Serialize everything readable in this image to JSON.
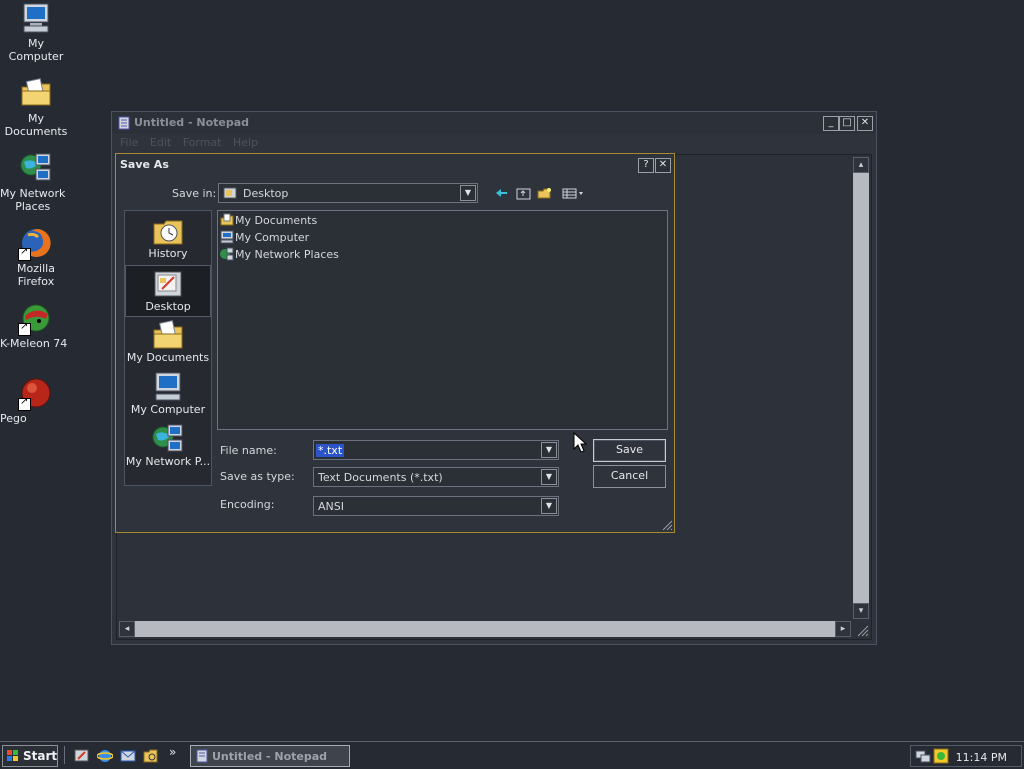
{
  "desktop": {
    "icons": [
      {
        "label": "My Computer"
      },
      {
        "label": "My Documents"
      },
      {
        "label_line1": "My Network",
        "label_line2": "Places"
      },
      {
        "label": "Mozilla Firefox"
      },
      {
        "label": "K-Meleon 74"
      },
      {
        "label": "Pego"
      }
    ]
  },
  "notepad": {
    "title": "Untitled - Notepad",
    "menu": [
      "File",
      "Edit",
      "Format",
      "Help"
    ],
    "controls": {
      "minimize": "_",
      "maximize": "□",
      "close": "✕"
    }
  },
  "dialog": {
    "title": "Save As",
    "help_btn": "?",
    "close_btn": "✕",
    "save_in_label": "Save in:",
    "save_in_value": "Desktop",
    "places": [
      "History",
      "Desktop",
      "My Documents",
      "My Computer",
      "My Network P..."
    ],
    "files": [
      "My Documents",
      "My Computer",
      "My Network Places"
    ],
    "file_name_label": "File name:",
    "file_name_value": "*.txt",
    "save_as_type_label": "Save as type:",
    "save_as_type_value": "Text Documents (*.txt)",
    "encoding_label": "Encoding:",
    "encoding_value": "ANSI",
    "save_button": "Save",
    "cancel_button": "Cancel",
    "toolbar_icons": [
      "back-icon",
      "up-folder-icon",
      "new-folder-icon",
      "views-menu-icon"
    ]
  },
  "taskbar": {
    "start_label": "Start",
    "task_label": "Untitled - Notepad",
    "clock": "11:14 PM",
    "quicklaunch": [
      "show-desktop-icon",
      "ie-icon",
      "outlook-icon",
      "explorer-icon"
    ],
    "chevron": "»"
  },
  "colors": {
    "desktop_bg": "#262a33",
    "dialog_border": "#a8892d",
    "selection": "#2a54c8"
  }
}
